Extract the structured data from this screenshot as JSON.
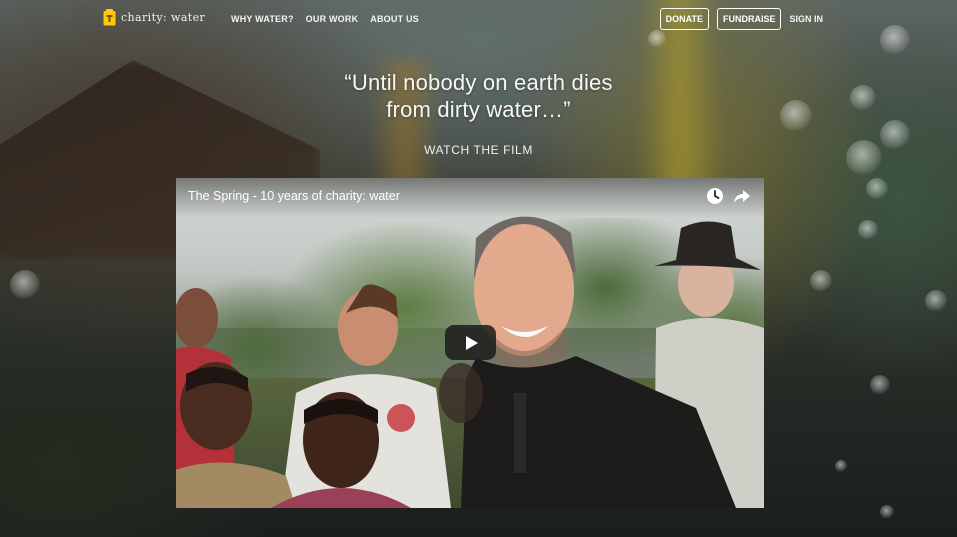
{
  "brand": {
    "name": "charity: water",
    "logo_icon": "jerry-can-icon",
    "accent": "#ffc907"
  },
  "nav": {
    "links": [
      "WHY WATER?",
      "OUR WORK",
      "ABOUT US"
    ],
    "donate_label": "DONATE",
    "fundraise_label": "FUNDRAISE",
    "signin_label": "SIGN IN"
  },
  "hero": {
    "quote_line1": "“Until nobody on earth dies",
    "quote_line2": "from dirty water…”",
    "cta": "WATCH THE FILM"
  },
  "video": {
    "title": "The Spring - 10 years of charity: water",
    "icons": [
      "watch-later-icon",
      "share-icon",
      "play-icon"
    ],
    "play_button_color": "#212121"
  }
}
